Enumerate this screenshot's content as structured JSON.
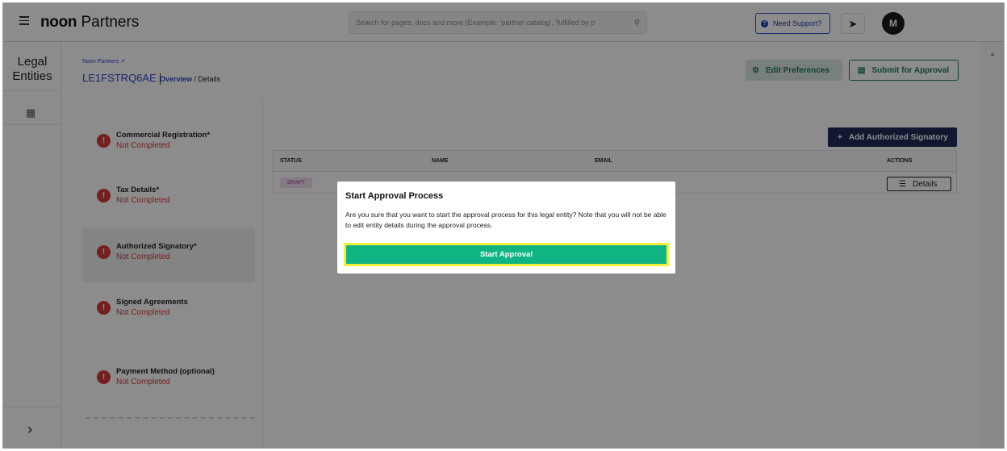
{
  "topbar": {
    "brand_bold": "noon",
    "brand_light": " Partners",
    "search_placeholder": "Search for pages, docs and more (Example: 'partner catalog', 'fulfilled by p",
    "support_label": "Need Support?",
    "avatar_initial": "M"
  },
  "leftnav": {
    "title_line1": "Legal",
    "title_line2": "Entities",
    "expand_glyph": "›"
  },
  "header": {
    "parent_link": "Noon Partners",
    "entity_id": "LE1FSTRQ6AE",
    "crumb_overview": "Overview",
    "crumb_sep": " / ",
    "crumb_details": "Details",
    "edit_preferences": "Edit Preferences",
    "submit_for_approval": "Submit for Approval"
  },
  "steps": [
    {
      "name": "Commercial Registration*",
      "status": "Not Completed"
    },
    {
      "name": "Tax Details*",
      "status": "Not Completed"
    },
    {
      "name": "Authorized Signatory*",
      "status": "Not Completed"
    },
    {
      "name": "Signed Agreements",
      "status": "Not Completed"
    },
    {
      "name": "Payment Method (optional)",
      "status": "Not Completed"
    }
  ],
  "signatory": {
    "add_button": "Add Authorized Signatory",
    "columns": [
      "STATUS",
      "NAME",
      "EMAIL",
      "ACTIONS"
    ],
    "row": {
      "status": "DRAFT",
      "action": "Details"
    }
  },
  "modal": {
    "title": "Start Approval Process",
    "body": "Are you sure that you want to start the approval process for this legal entity? Note that you will not be able to edit entity details during the approval process.",
    "confirm": "Start Approval"
  },
  "colors": {
    "accent_green": "#10b482",
    "navy": "#1e2a57",
    "error_red": "#d33b3b",
    "highlight_yellow": "#f3ef3a"
  },
  "icons": [
    "menu-icon",
    "search-icon",
    "help-icon",
    "rocket-icon",
    "list-icon",
    "chevron-right-icon",
    "gear-icon",
    "submit-icon",
    "plus-icon",
    "details-icon",
    "error-icon"
  ]
}
